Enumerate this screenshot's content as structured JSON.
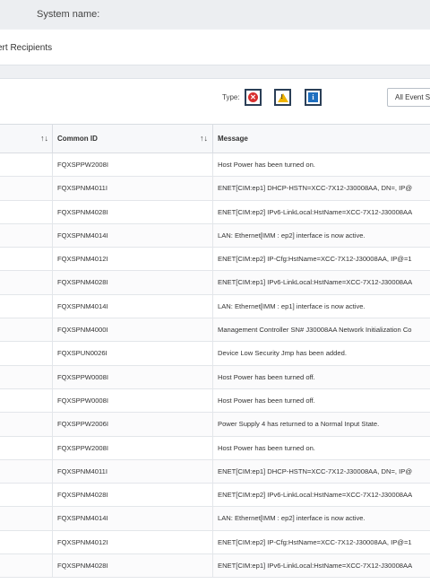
{
  "header": {
    "system_name_label": "System name:"
  },
  "breadcrumb": {
    "text": "ert Recipients"
  },
  "filters": {
    "type_label": "Type:",
    "type_buttons": [
      {
        "name": "error",
        "icon": "error-icon",
        "glyph": "✕",
        "color": "#d8302f"
      },
      {
        "name": "warning",
        "icon": "warning-icon",
        "glyph": "!",
        "color": "#f0b400"
      },
      {
        "name": "info",
        "icon": "info-icon",
        "glyph": "i",
        "color": "#1f6fbf"
      }
    ],
    "events_select": "All Event S"
  },
  "table": {
    "columns": [
      "",
      "Common ID",
      "Message"
    ],
    "sort_glyph": "↑↓",
    "rows": [
      {
        "id": "FQXSPPW2008I",
        "message": "Host Power has been turned on."
      },
      {
        "id": "FQXSPNM4011I",
        "message": "ENET[CIM:ep1] DHCP-HSTN=XCC-7X12-J30008AA, DN=, IP@"
      },
      {
        "id": "FQXSPNM4028I",
        "message": "ENET[CIM:ep2] IPv6-LinkLocal:HstName=XCC-7X12-J30008AA"
      },
      {
        "id": "FQXSPNM4014I",
        "message": "LAN: Ethernet[IMM : ep2] interface is now active."
      },
      {
        "id": "FQXSPNM4012I",
        "message": "ENET[CIM:ep2] IP-Cfg:HstName=XCC-7X12-J30008AA, IP@=1"
      },
      {
        "id": "FQXSPNM4028I",
        "message": "ENET[CIM:ep1] IPv6-LinkLocal:HstName=XCC-7X12-J30008AA"
      },
      {
        "id": "FQXSPNM4014I",
        "message": "LAN: Ethernet[IMM : ep1] interface is now active."
      },
      {
        "id": "FQXSPNM4000I",
        "message": "Management Controller SN# J30008AA Network Initialization Co"
      },
      {
        "id": "FQXSPUN0026I",
        "message": "Device Low Security Jmp has been added."
      },
      {
        "id": "FQXSPPW0008I",
        "message": "Host Power has been turned off."
      },
      {
        "id": "FQXSPPW0008I",
        "message": "Host Power has been turned off."
      },
      {
        "id": "FQXSPPW2006I",
        "message": "Power Supply 4 has returned to a Normal Input State."
      },
      {
        "id": "FQXSPPW2008I",
        "message": "Host Power has been turned on."
      },
      {
        "id": "FQXSPNM4011I",
        "message": "ENET[CIM:ep1] DHCP-HSTN=XCC-7X12-J30008AA, DN=, IP@"
      },
      {
        "id": "FQXSPNM4028I",
        "message": "ENET[CIM:ep2] IPv6-LinkLocal:HstName=XCC-7X12-J30008AA"
      },
      {
        "id": "FQXSPNM4014I",
        "message": "LAN: Ethernet[IMM : ep2] interface is now active."
      },
      {
        "id": "FQXSPNM4012I",
        "message": "ENET[CIM:ep2] IP-Cfg:HstName=XCC-7X12-J30008AA, IP@=1"
      },
      {
        "id": "FQXSPNM4028I",
        "message": "ENET[CIM:ep1] IPv6-LinkLocal:HstName=XCC-7X12-J30008AA"
      }
    ]
  }
}
